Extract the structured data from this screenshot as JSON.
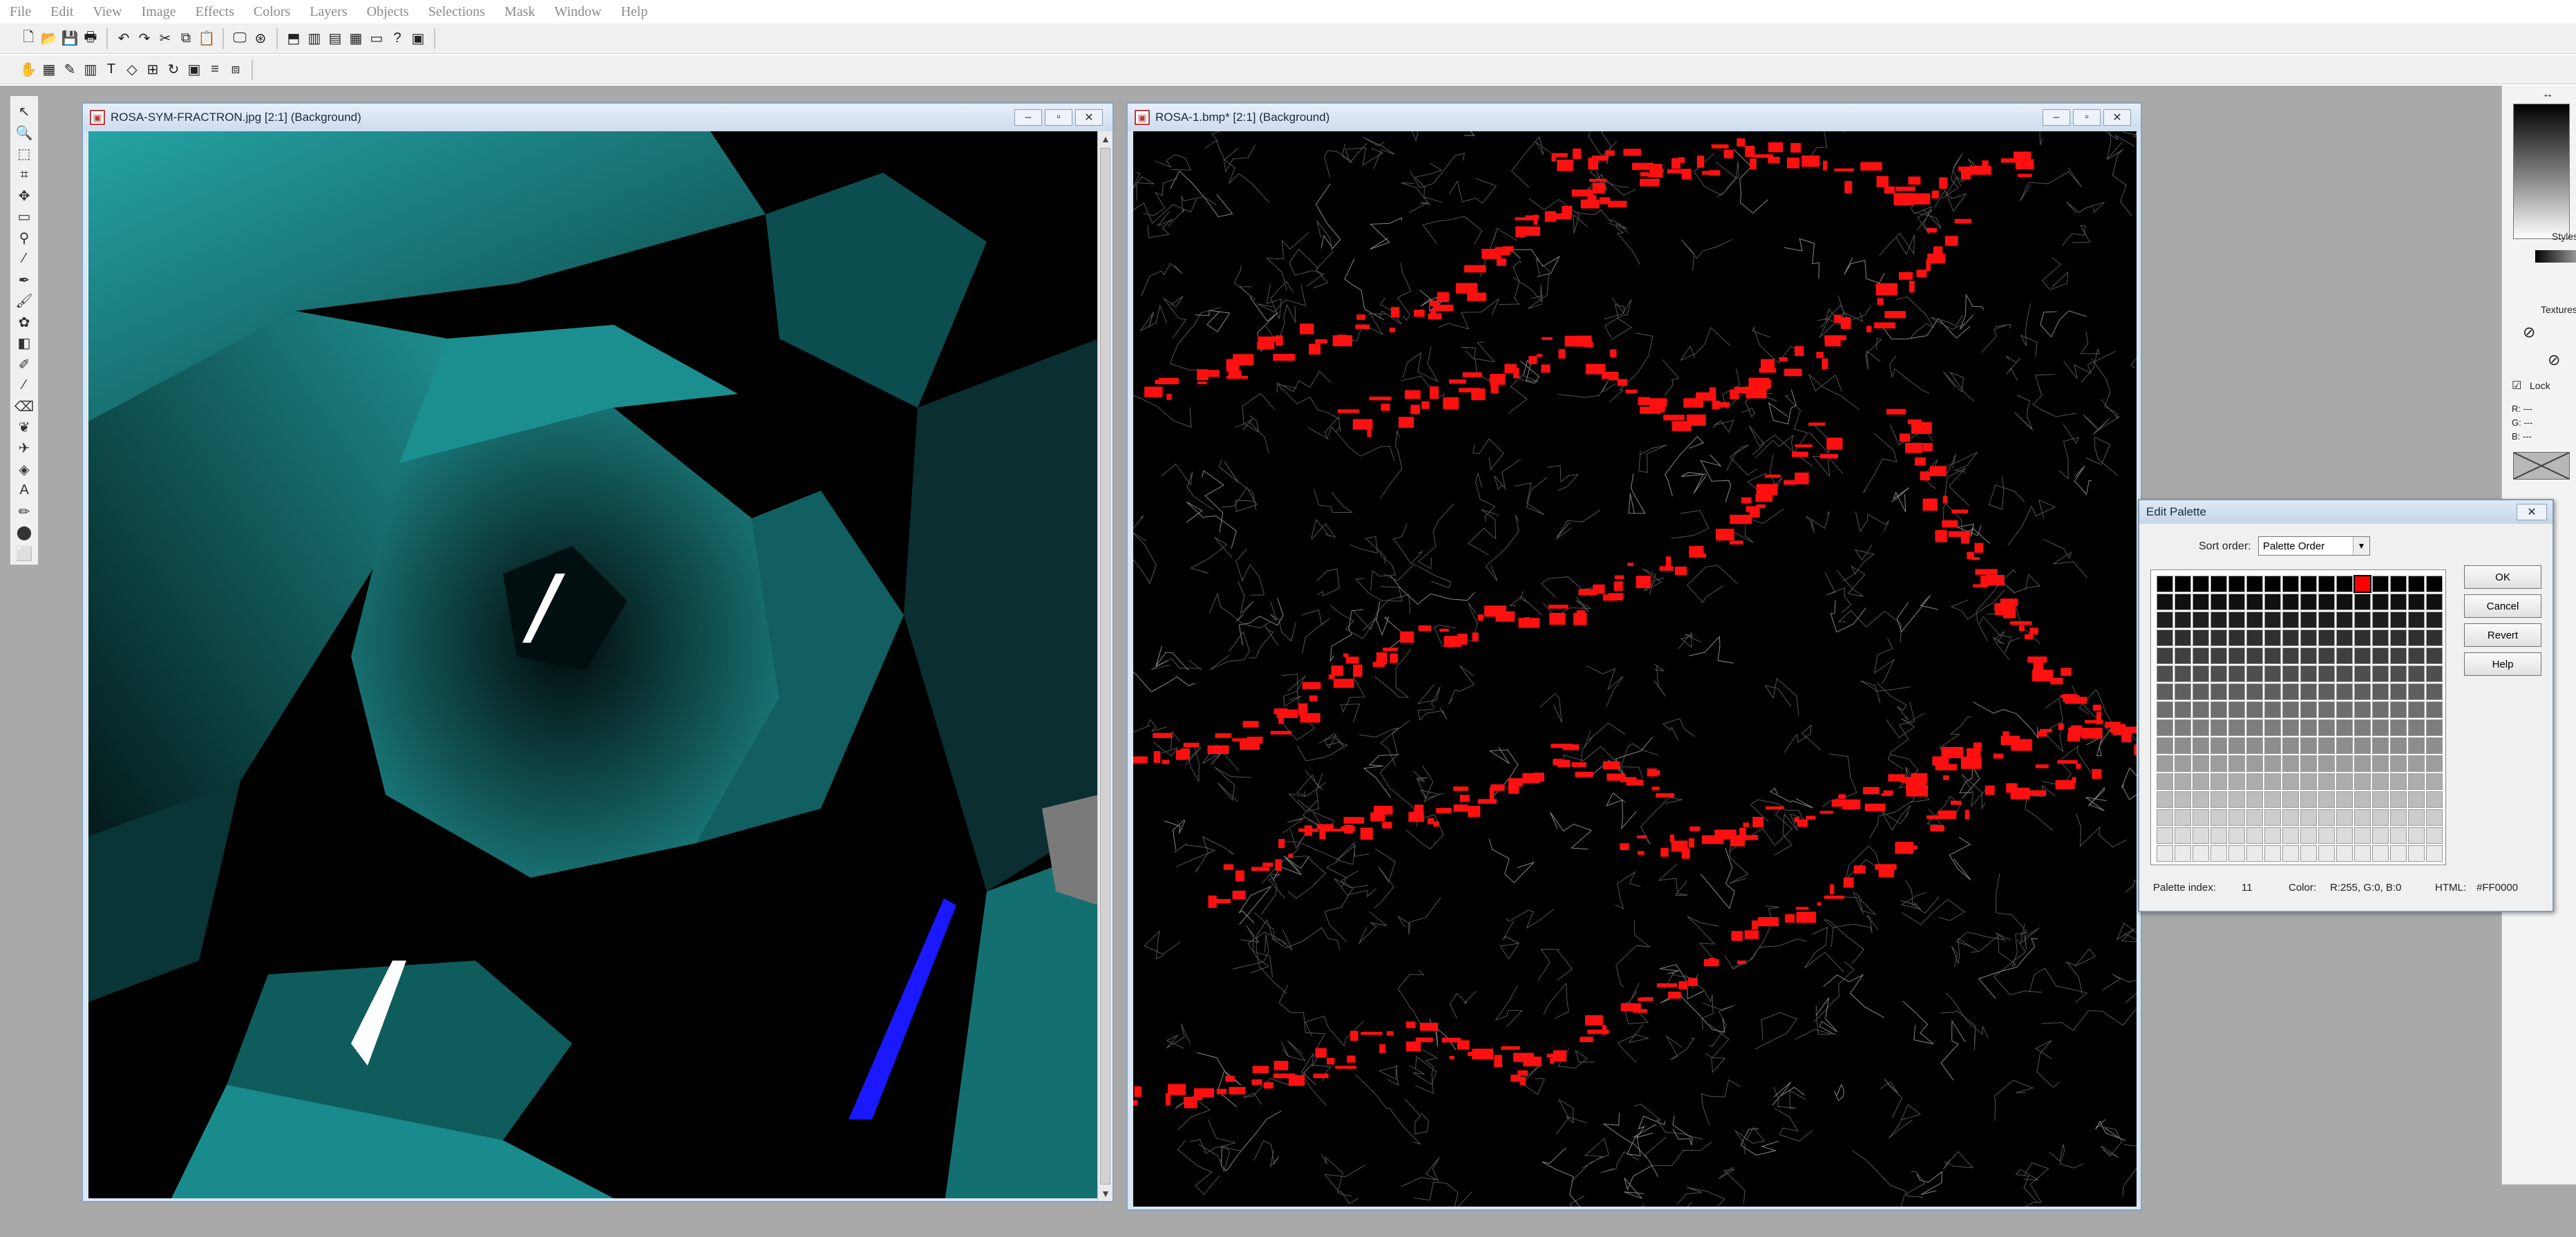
{
  "menu": [
    "File",
    "Edit",
    "View",
    "Image",
    "Effects",
    "Colors",
    "Layers",
    "Objects",
    "Selections",
    "Mask",
    "Window",
    "Help"
  ],
  "toolbar1": [
    {
      "icon": "new-file-icon",
      "glyph": "🗋"
    },
    {
      "icon": "open-icon",
      "glyph": "📂"
    },
    {
      "icon": "save-icon",
      "glyph": "💾"
    },
    {
      "icon": "print-icon",
      "glyph": "🖶"
    },
    {
      "icon": "undo-icon",
      "glyph": "↶"
    },
    {
      "icon": "redo-icon",
      "glyph": "↷"
    },
    {
      "icon": "cut-icon",
      "glyph": "✂"
    },
    {
      "icon": "copy-icon",
      "glyph": "⧉"
    },
    {
      "icon": "paste-icon",
      "glyph": "📋"
    },
    {
      "icon": "full-screen-icon",
      "glyph": "🖵"
    },
    {
      "icon": "browse-icon",
      "glyph": "⊛"
    },
    {
      "icon": "palette-icon",
      "glyph": "⬒"
    },
    {
      "icon": "histogram-icon",
      "glyph": "▥"
    },
    {
      "icon": "layers-icon",
      "glyph": "▤"
    },
    {
      "icon": "overview-icon",
      "glyph": "▦"
    },
    {
      "icon": "controls-icon",
      "glyph": "▭"
    },
    {
      "icon": "help-icon",
      "glyph": "?"
    },
    {
      "icon": "camera-icon",
      "glyph": "▣"
    }
  ],
  "toolbar2": [
    {
      "icon": "pan-icon",
      "glyph": "✋"
    },
    {
      "icon": "layer-icon",
      "glyph": "▦"
    },
    {
      "icon": "brush-icon",
      "glyph": "✎"
    },
    {
      "icon": "mask-icon",
      "glyph": "▥"
    },
    {
      "icon": "text-icon",
      "glyph": "T"
    },
    {
      "icon": "shape-icon",
      "glyph": "◇"
    },
    {
      "icon": "grid-icon",
      "glyph": "⊞"
    },
    {
      "icon": "rotate-icon",
      "glyph": "↻"
    },
    {
      "icon": "frame-icon",
      "glyph": "▣"
    },
    {
      "icon": "align-icon",
      "glyph": "≡"
    },
    {
      "icon": "arrange-icon",
      "glyph": "⧈"
    }
  ],
  "tools": [
    {
      "icon": "arrow-tool-icon",
      "glyph": "↖"
    },
    {
      "icon": "zoom-tool-icon",
      "glyph": "🔍"
    },
    {
      "icon": "deform-tool-icon",
      "glyph": "⬚"
    },
    {
      "icon": "crop-tool-icon",
      "glyph": "⌗"
    },
    {
      "icon": "move-tool-icon",
      "glyph": "✥"
    },
    {
      "icon": "selection-tool-icon",
      "glyph": "▭"
    },
    {
      "icon": "freehand-tool-icon",
      "glyph": "⚲"
    },
    {
      "icon": "magic-wand-tool-icon",
      "glyph": "⁄"
    },
    {
      "icon": "dropper-tool-icon",
      "glyph": "✒"
    },
    {
      "icon": "paint-brush-tool-icon",
      "glyph": "🖌"
    },
    {
      "icon": "clone-brush-tool-icon",
      "glyph": "✿"
    },
    {
      "icon": "color-replacer-tool-icon",
      "glyph": "◧"
    },
    {
      "icon": "retouch-tool-icon",
      "glyph": "✐"
    },
    {
      "icon": "scratch-remover-tool-icon",
      "glyph": "⁄"
    },
    {
      "icon": "eraser-tool-icon",
      "glyph": "⌫"
    },
    {
      "icon": "picture-tube-tool-icon",
      "glyph": "❦"
    },
    {
      "icon": "airbrush-tool-icon",
      "glyph": "✈"
    },
    {
      "icon": "flood-fill-tool-icon",
      "glyph": "◈"
    },
    {
      "icon": "text-tool-icon",
      "glyph": "A"
    },
    {
      "icon": "draw-tool-icon",
      "glyph": "✏"
    },
    {
      "icon": "preset-shapes-tool-icon",
      "glyph": "⬤"
    },
    {
      "icon": "object-selector-tool-icon",
      "glyph": "⬜"
    }
  ],
  "windows": [
    {
      "title": "ROSA-SYM-FRACTRON.jpg [2:1] (Background)"
    },
    {
      "title": "ROSA-1.bmp* [2:1] (Background)"
    }
  ],
  "right_panel": {
    "style_label": "Styles",
    "texture_label": "Textures",
    "lock_label": "Lock",
    "r": "R: ---",
    "g": "G: ---",
    "b": "B: ---"
  },
  "dialog": {
    "title": "Edit Palette",
    "sort_label": "Sort order:",
    "sort_value": "Palette Order",
    "buttons": [
      "OK",
      "Cancel",
      "Revert",
      "Help"
    ],
    "palette_index_label": "Palette index:",
    "palette_index": "11",
    "color_label": "Color:",
    "color_value": "R:255, G:0, B:0",
    "html_label": "HTML:",
    "html_value": "#FF0000",
    "selected_color": "#FF0000",
    "selected_index": 11
  },
  "colors": {
    "workspace": "#a9a9a9",
    "teal": "#19797b",
    "red": "#ff1010",
    "blue": "#1a18ff"
  }
}
